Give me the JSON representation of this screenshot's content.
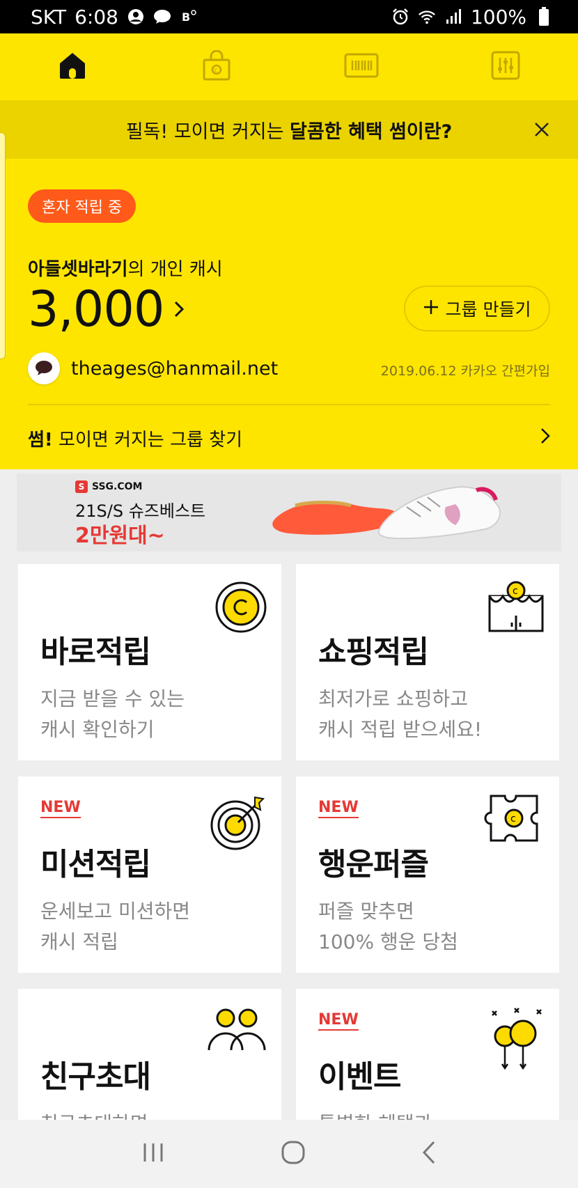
{
  "status_bar": {
    "carrier": "SKT",
    "time": "6:08",
    "battery": "100%",
    "left_icons": [
      "person-circle-icon",
      "talk-icon",
      "b-icon"
    ],
    "right_icons": [
      "alarm-icon",
      "wifi-icon",
      "signal-icon",
      "battery-icon"
    ]
  },
  "top_nav": {
    "tabs": [
      {
        "name": "home-icon",
        "active": true
      },
      {
        "name": "shopping-bag-icon",
        "active": false
      },
      {
        "name": "barcode-icon",
        "active": false
      },
      {
        "name": "settings-sliders-icon",
        "active": false
      }
    ]
  },
  "notice": {
    "text_normal": "필독! 모이면 커지는 ",
    "text_bold": "달콤한 혜택 썸이란?"
  },
  "account": {
    "badge": "혼자 적립 중",
    "owner_name": "아들셋바라기",
    "owner_suffix": "의 개인 캐시",
    "cash": "3,000",
    "group_button": "그룹 만들기",
    "email": "theages@hanmail.net",
    "joined": "2019.06.12 카카오 간편가입",
    "find_bold": "썸!",
    "find_text": " 모이면 커지는 그룹 찾기"
  },
  "ad": {
    "brand": "SSG.COM",
    "line1": "21S/S 슈즈베스트",
    "line2": "2만원대~"
  },
  "cards": [
    {
      "title": "바로적립",
      "desc": "지금 받을 수 있는\n캐시 확인하기",
      "new": "",
      "icon": "coin-icon"
    },
    {
      "title": "쇼핑적립",
      "desc": "최저가로 쇼핑하고\n캐시 적립 받으세요!",
      "new": "",
      "icon": "store-icon"
    },
    {
      "title": "미션적립",
      "desc": "운세보고 미션하면\n캐시 적립",
      "new": "NEW",
      "icon": "target-icon"
    },
    {
      "title": "행운퍼즐",
      "desc": "퍼즐 맞추면\n100% 행운 당첨",
      "new": "NEW",
      "icon": "puzzle-icon"
    },
    {
      "title": "친구초대",
      "desc": "친구초대하면",
      "new": "",
      "icon": "friends-icon"
    },
    {
      "title": "이벤트",
      "desc": "특별한 혜택과",
      "new": "NEW",
      "icon": "balloons-icon"
    }
  ],
  "nav_bar": {
    "buttons": [
      "recent-apps-icon",
      "home-button-icon",
      "back-icon"
    ]
  },
  "colors": {
    "yellow": "#fee500",
    "notice_bg": "#ebd300",
    "badge": "#ff5a1a",
    "new_red": "#e53935"
  }
}
